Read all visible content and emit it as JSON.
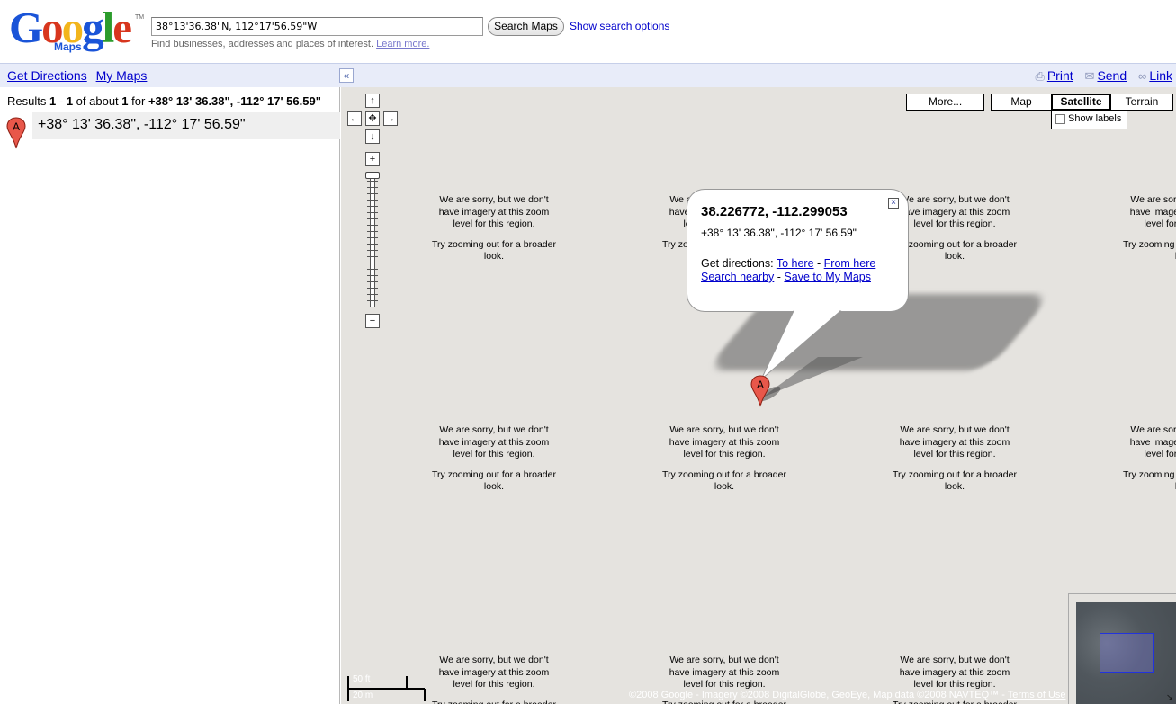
{
  "header": {
    "logo_text": "Google",
    "logo_sub": "Maps",
    "logo_tm": "TM",
    "search_value": "38°13'36.38\"N, 112°17'56.59\"W",
    "search_button": "Search Maps",
    "show_options": "Show search options",
    "hint_text": "Find businesses, addresses and places of interest.",
    "learn_more": "Learn more."
  },
  "bar": {
    "get_directions": "Get Directions",
    "my_maps": "My Maps",
    "collapse_icon": "«",
    "print": "Print",
    "send": "Send",
    "link": "Link"
  },
  "results": {
    "prefix": "Results",
    "from": "1",
    "dash": "-",
    "to": "1",
    "of_about": "of about",
    "total": "1",
    "for": "for",
    "query": "+38° 13' 36.38\", -112° 17' 56.59\"",
    "item_label": "+38° 13' 36.38\", -112° 17' 56.59\"",
    "marker_letter": "A"
  },
  "map": {
    "no_imagery_1": "We are sorry, but we don't have imagery at this zoom level for this region.",
    "no_imagery_2": "Try zooming out for a broader look.",
    "controls": {
      "pan_up": "↑",
      "pan_down": "↓",
      "pan_left": "←",
      "pan_right": "→",
      "zoom_in": "+",
      "zoom_out": "−"
    },
    "zoom_level_fraction": 0.0,
    "types": {
      "more": "More...",
      "map": "Map",
      "satellite": "Satellite",
      "terrain": "Terrain",
      "active": "Satellite"
    },
    "show_labels": "Show labels",
    "show_labels_checked": false,
    "bubble": {
      "title": "38.226772, -112.299053",
      "dms": "+38° 13' 36.38\", -112° 17' 56.59\"",
      "get_directions": "Get directions:",
      "to_here": "To here",
      "from_here": "From here",
      "search_nearby": "Search nearby",
      "save_to_my_maps": "Save to My Maps",
      "close": "×"
    },
    "marker_letter": "A",
    "scale_ft": "50 ft",
    "scale_m": "20 m",
    "copyright": "©2008 Google - Imagery ©2008 DigitalGlobe, GeoEye, Map data ©2008 NAVTEQ™ -",
    "terms": "Terms of Use",
    "overview_toggle": "↘"
  },
  "colors": {
    "link": "#0000cc",
    "bar_bg": "#e8ecf9",
    "map_bg": "#e5e3df",
    "marker": "#e8574a"
  }
}
